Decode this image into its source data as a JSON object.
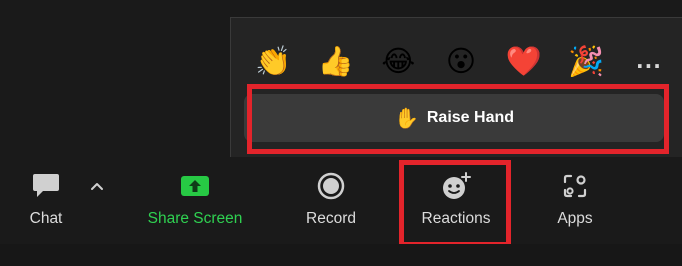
{
  "reactions_popup": {
    "emojis": [
      {
        "name": "clapping-hands",
        "glyph": "👏"
      },
      {
        "name": "thumbs-up",
        "glyph": "👍"
      },
      {
        "name": "tears-of-joy",
        "glyph": "😂"
      },
      {
        "name": "open-mouth",
        "glyph": "😮"
      },
      {
        "name": "red-heart",
        "glyph": "❤️"
      },
      {
        "name": "party-popper",
        "glyph": "🎉"
      }
    ],
    "more_label": "...",
    "raise_hand": {
      "icon": "✋",
      "label": "Raise Hand"
    }
  },
  "toolbar": {
    "chat_label": "Chat",
    "share_label": "Share Screen",
    "record_label": "Record",
    "reactions_label": "Reactions",
    "apps_label": "Apps"
  },
  "colors": {
    "background": "#1a1a1a",
    "popup": "#242424",
    "raise_button": "#3a3a3a",
    "share_green": "#2fd151",
    "highlight_red": "#e3242b",
    "label_text": "#dcdcdc"
  },
  "highlights": [
    "raise-hand-button",
    "reactions-button"
  ]
}
